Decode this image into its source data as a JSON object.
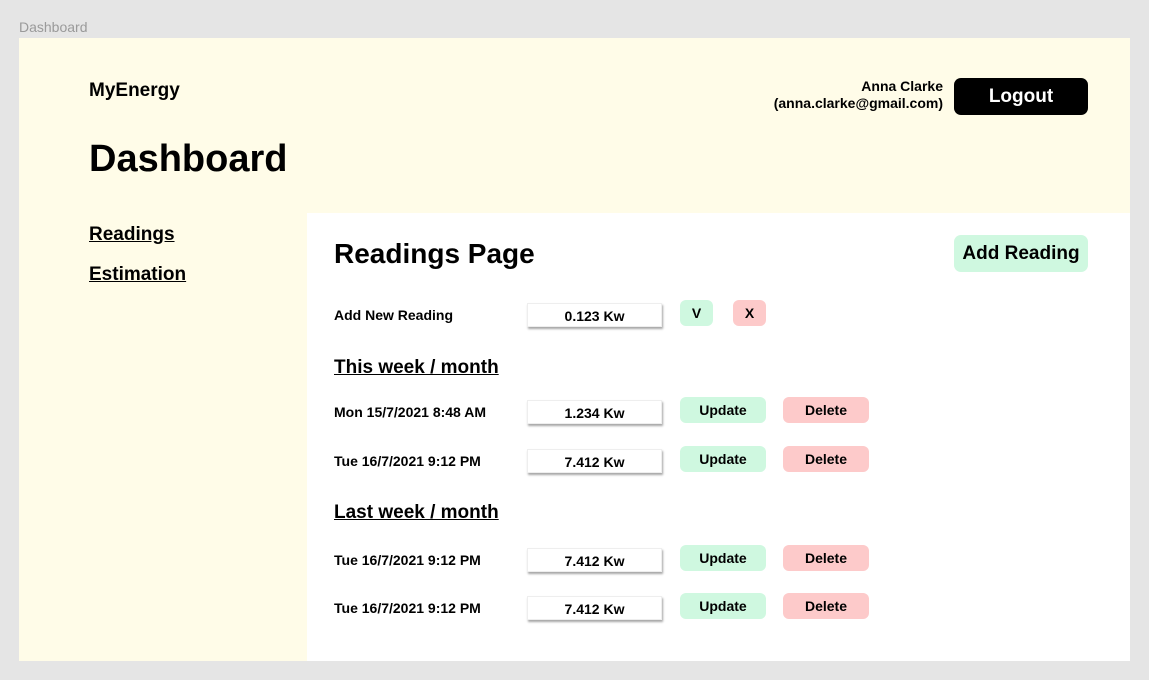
{
  "frame_label": "Dashboard",
  "header": {
    "brand": "MyEnergy",
    "user_name": "Anna Clarke",
    "user_email": "(anna.clarke@gmail.com)",
    "logout_label": "Logout",
    "page_title": "Dashboard"
  },
  "nav": {
    "readings": "Readings",
    "estimation": "Estimation"
  },
  "main": {
    "title": "Readings Page",
    "add_reading_label": "Add Reading",
    "new_reading": {
      "label": "Add New Reading",
      "value": "0.123 Kw",
      "confirm_label": "V",
      "cancel_label": "X"
    },
    "update_label": "Update",
    "delete_label": "Delete",
    "sections": [
      {
        "title": "This week / month",
        "rows": [
          {
            "date": "Mon 15/7/2021 8:48 AM",
            "value": "1.234 Kw"
          },
          {
            "date": "Tue 16/7/2021 9:12 PM",
            "value": "7.412 Kw"
          }
        ]
      },
      {
        "title": "Last week / month",
        "rows": [
          {
            "date": "Tue 16/7/2021 9:12 PM",
            "value": "7.412 Kw"
          },
          {
            "date": "Tue 16/7/2021 9:12 PM",
            "value": "7.412 Kw"
          }
        ]
      }
    ]
  },
  "colors": {
    "frame_bg": "#fffce8",
    "confirm": "#cff8e0",
    "danger": "#fdcaca"
  }
}
